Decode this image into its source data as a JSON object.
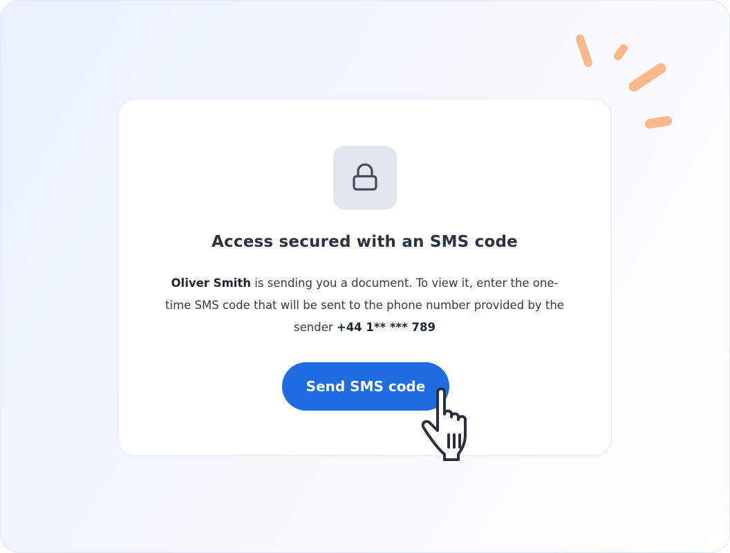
{
  "card": {
    "title": "Access secured with an SMS code",
    "sender_name": "Oliver Smith",
    "message_part1": " is sending you a document. To view it, enter the one-time SMS code that will be sent to the phone number provided by the sender ",
    "phone_masked": "+44 1** *** 789",
    "send_button_label": "Send SMS code",
    "lock_icon": "lock-icon"
  },
  "decor": {
    "accent_color": "#f9b98a",
    "cursor_icon": "hand-pointer-icon"
  },
  "colors": {
    "primary_button": "#1f6be0",
    "title_text": "#2a3340",
    "lock_tile_bg": "#e2e7ee"
  }
}
